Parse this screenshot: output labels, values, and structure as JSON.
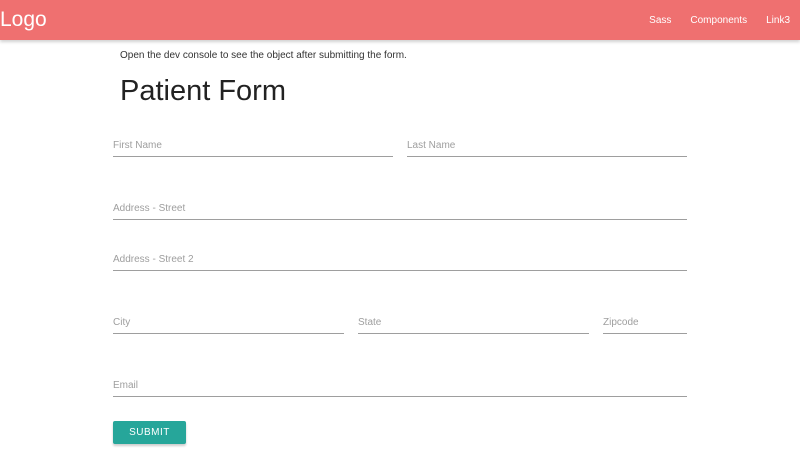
{
  "navbar": {
    "logo": "Logo",
    "links": [
      "Sass",
      "Components",
      "Link3"
    ]
  },
  "page": {
    "note": "Open the dev console to see the object after submitting the form.",
    "title": "Patient Form"
  },
  "form": {
    "first_name": {
      "placeholder": "First Name",
      "value": ""
    },
    "last_name": {
      "placeholder": "Last Name",
      "value": ""
    },
    "street": {
      "placeholder": "Address - Street",
      "value": ""
    },
    "street2": {
      "placeholder": "Address - Street 2",
      "value": ""
    },
    "city": {
      "placeholder": "City",
      "value": ""
    },
    "state": {
      "placeholder": "State",
      "value": ""
    },
    "zipcode": {
      "placeholder": "Zipcode",
      "value": ""
    },
    "email": {
      "placeholder": "Email",
      "value": ""
    },
    "submit_label": "SUBMIT"
  },
  "colors": {
    "navbar": "#ef7070",
    "button": "#26a69a",
    "underline": "#9e9e9e"
  }
}
